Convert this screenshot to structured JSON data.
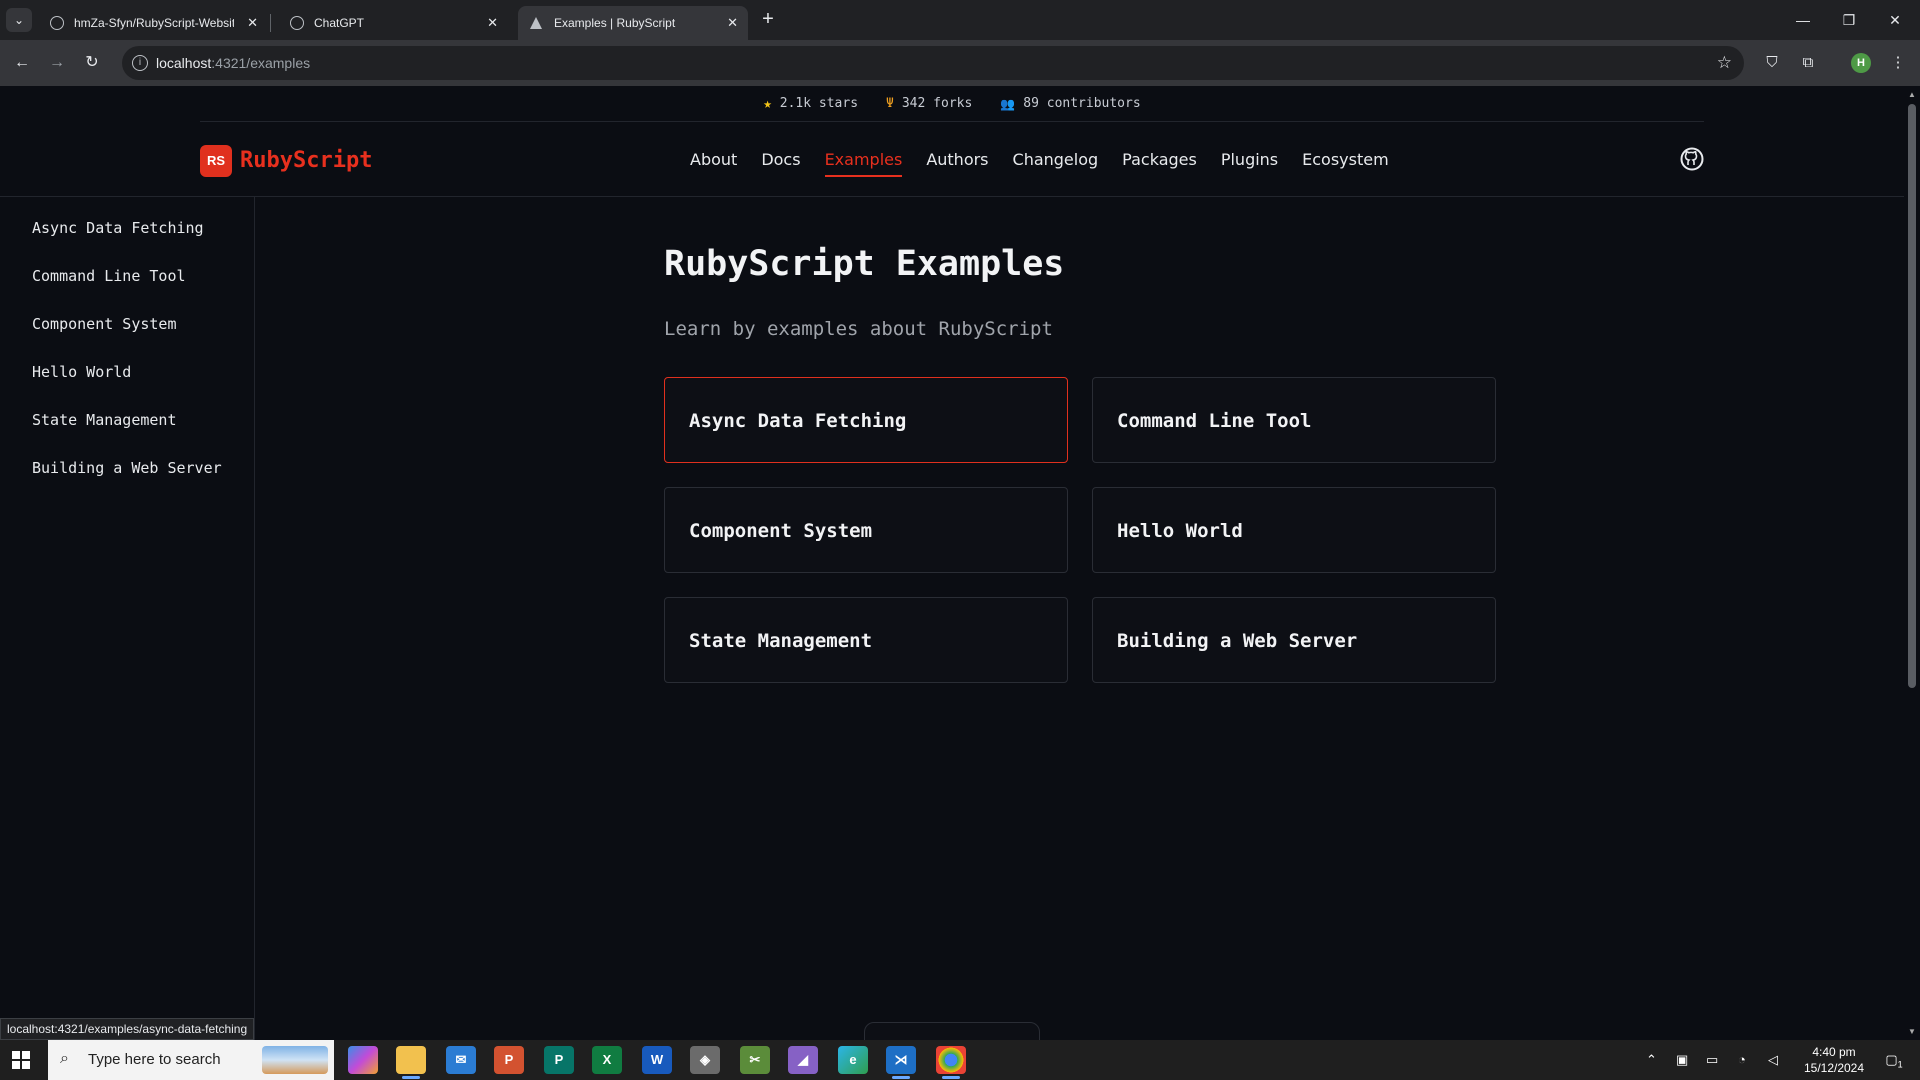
{
  "browser": {
    "tabs": [
      {
        "title": "hmZa-Sfyn/RubyScript-Website",
        "active": false
      },
      {
        "title": "ChatGPT",
        "active": false
      },
      {
        "title": "Examples | RubyScript",
        "active": true
      }
    ],
    "tab_close": "✕",
    "new_tab": "+",
    "url_host": "localhost",
    "url_rest": ":4321/examples",
    "profile_initial": "H"
  },
  "stats": {
    "stars": "2.1k stars",
    "forks": "342 forks",
    "contributors": "89 contributors"
  },
  "brand": {
    "badge": "RS",
    "name": "RubyScript",
    "accent": "#e8301e"
  },
  "nav": {
    "items": [
      {
        "label": "About",
        "active": false
      },
      {
        "label": "Docs",
        "active": false
      },
      {
        "label": "Examples",
        "active": true
      },
      {
        "label": "Authors",
        "active": false
      },
      {
        "label": "Changelog",
        "active": false
      },
      {
        "label": "Packages",
        "active": false
      },
      {
        "label": "Plugins",
        "active": false
      },
      {
        "label": "Ecosystem",
        "active": false
      }
    ]
  },
  "sidebar": {
    "items": [
      "Async Data Fetching",
      "Command Line Tool",
      "Component System",
      "Hello World",
      "State Management",
      "Building a Web Server"
    ]
  },
  "main": {
    "title": "RubyScript Examples",
    "subtitle": "Learn by examples about RubyScript",
    "cards": [
      {
        "label": "Async Data Fetching",
        "hovered": true
      },
      {
        "label": "Command Line Tool",
        "hovered": false
      },
      {
        "label": "Component System",
        "hovered": false
      },
      {
        "label": "Hello World",
        "hovered": false
      },
      {
        "label": "State Management",
        "hovered": false
      },
      {
        "label": "Building a Web Server",
        "hovered": false
      }
    ]
  },
  "status_bar": {
    "url": "localhost:4321/examples/async-data-fetching"
  },
  "taskbar": {
    "search_placeholder": "Type here to search",
    "time": "4:40 pm",
    "date": "15/12/2024",
    "notifications": "1"
  }
}
